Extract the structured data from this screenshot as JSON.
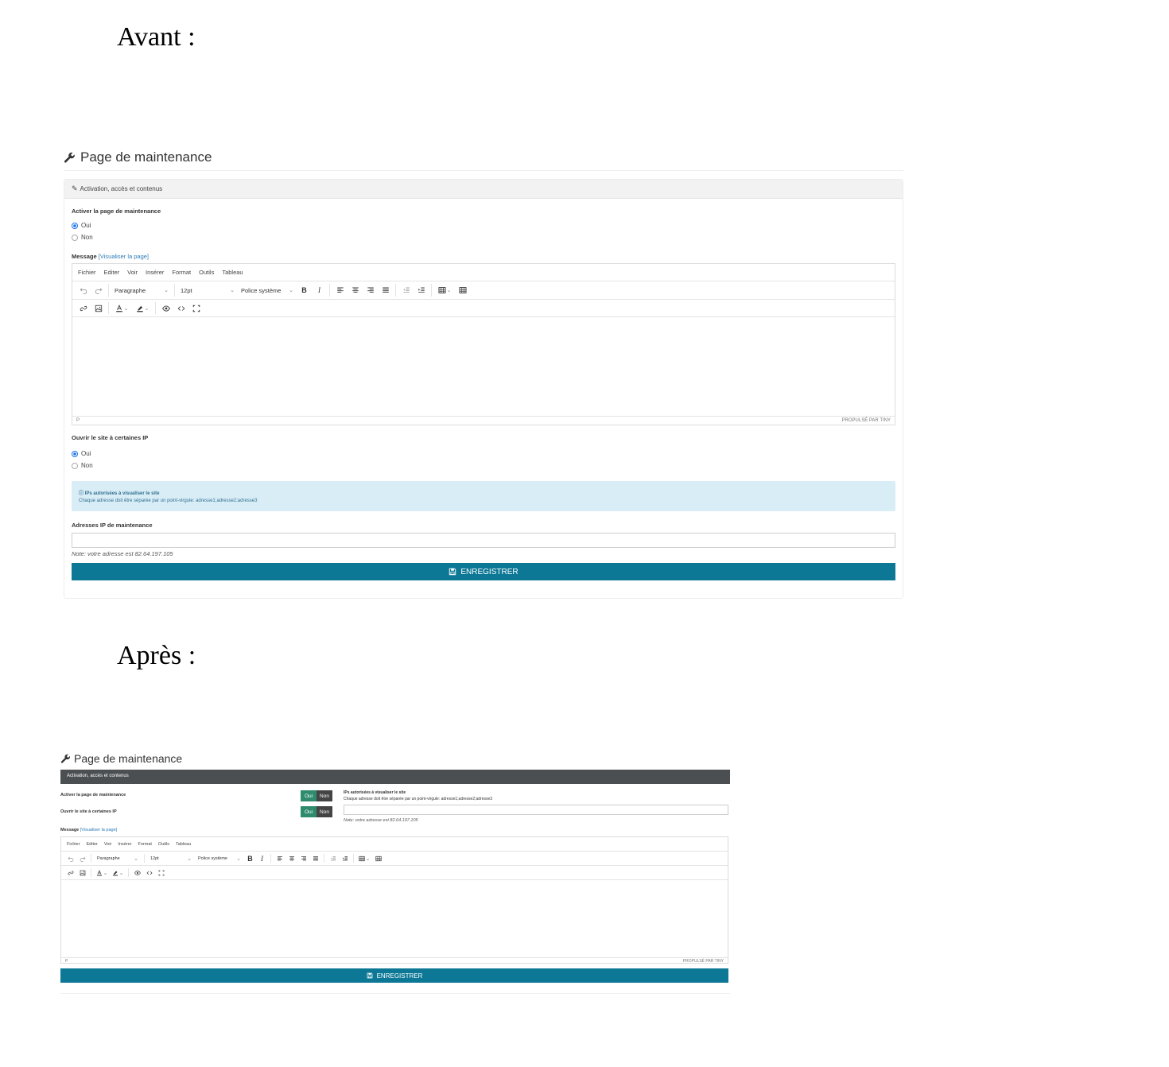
{
  "headings": {
    "before": "Avant :",
    "after": "Après :"
  },
  "page": {
    "title": "Page de maintenance",
    "panel_title": "Activation, accès et contenus"
  },
  "form": {
    "activate_label": "Activer la page de maintenance",
    "open_ip_label": "Ouvrir le site à certaines IP",
    "yes": "Oui",
    "no": "Non",
    "message_label": "Message",
    "preview_link": "[Visualiser la page]",
    "info_title": "IPs autorisées à visualiser le site",
    "info_text": "Chaque adresse doit être séparée par un point-virgule: adresse1;adresse2;adresse3",
    "ip_label": "Adresses IP de maintenance",
    "ip_value": "",
    "note": "Note: votre adresse est 82.64.197.105",
    "save_label": "ENREGISTRER"
  },
  "state": {
    "before": {
      "activate": "Oui",
      "open_ip": "Oui"
    }
  },
  "editor": {
    "menu": [
      "Fichier",
      "Editer",
      "Voir",
      "Insérer",
      "Format",
      "Outils",
      "Tableau"
    ],
    "block_format": "Paragraphe",
    "font_size": "12pt",
    "font_family": "Police système",
    "status_path": "P",
    "branding": "PROPULSÉ PAR TINY"
  },
  "icons": [
    "wrench-icon",
    "edit-icon",
    "info-icon",
    "save-icon",
    "undo-icon",
    "redo-icon",
    "bold-icon",
    "italic-icon",
    "align-left-icon",
    "align-center-icon",
    "align-right-icon",
    "align-justify-icon",
    "outdent-icon",
    "indent-icon",
    "table-icon",
    "link-icon",
    "image-icon",
    "text-color-icon",
    "highlight-icon",
    "preview-icon",
    "code-icon",
    "fullscreen-icon"
  ],
  "colors": {
    "primary": "#0d7896",
    "toggle_yes": "#2e8b6e",
    "toggle_no": "#444444",
    "dark_header": "#4b4f52",
    "info_bg": "#d9edf7",
    "link": "#2a7ab8"
  }
}
